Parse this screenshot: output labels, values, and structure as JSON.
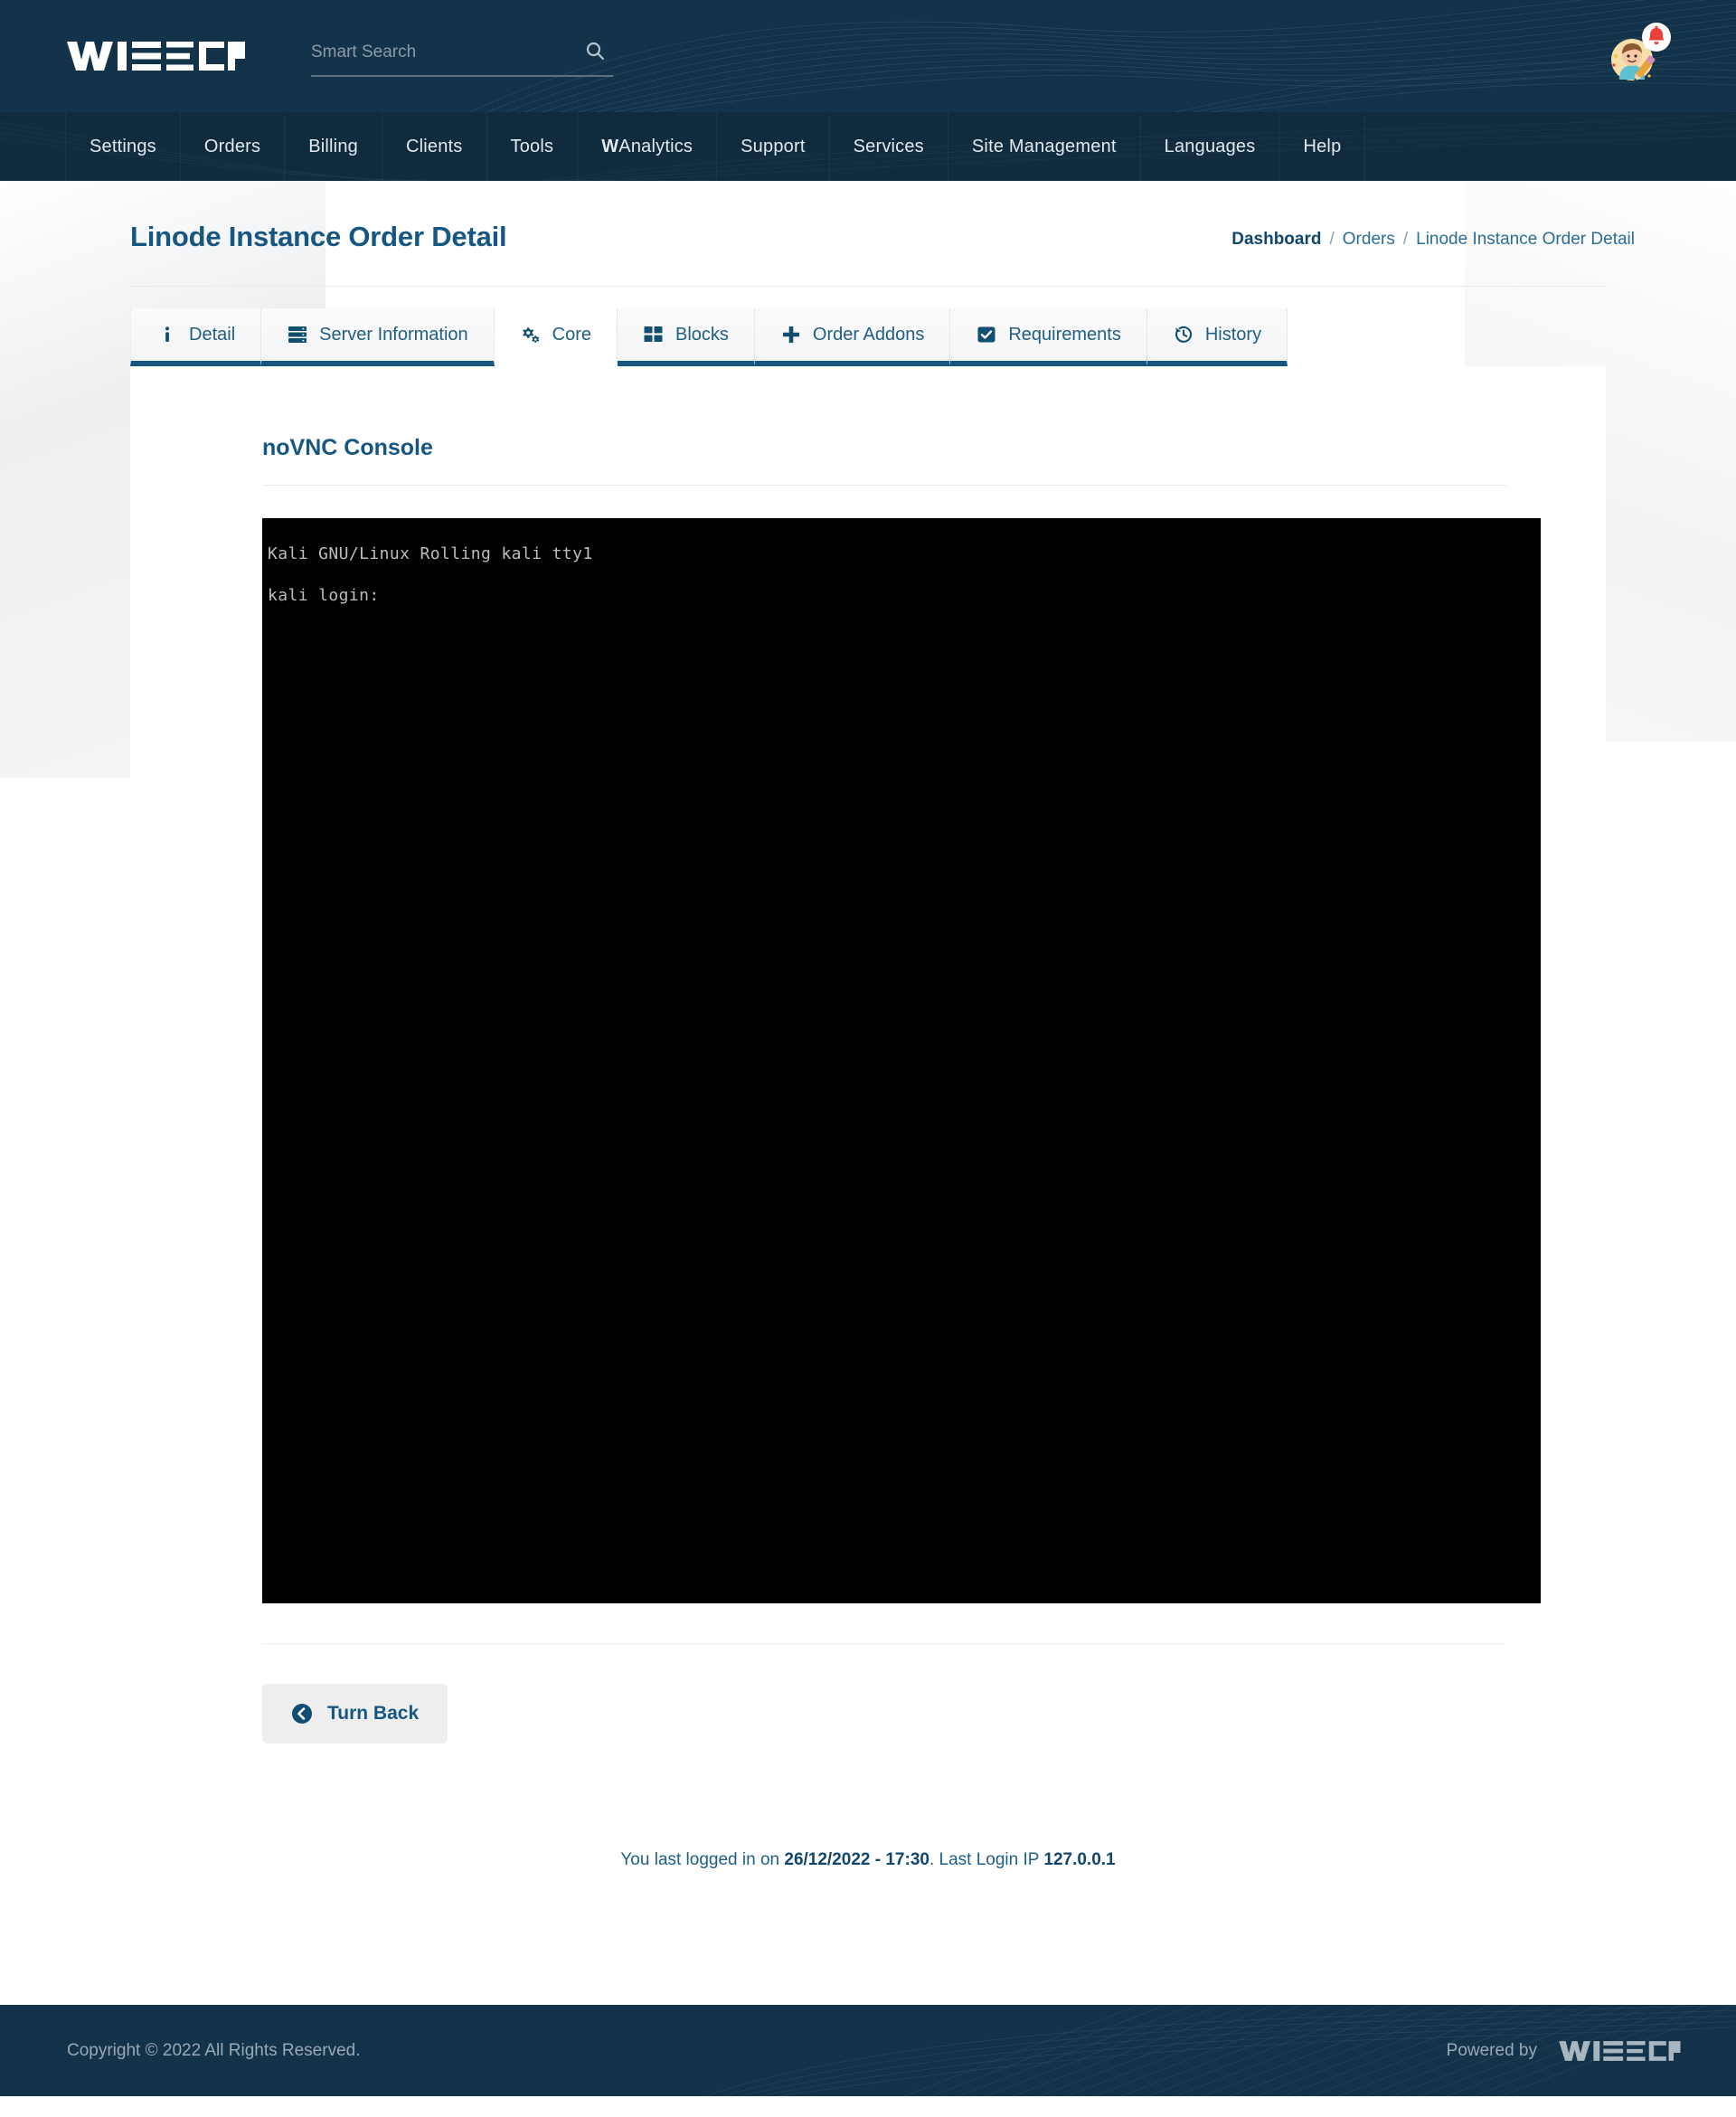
{
  "brand": {
    "logo_text": "WISECP",
    "accent": "#155682",
    "header_bg": "#123349",
    "nav_bg": "#0f2b3d"
  },
  "header": {
    "search": {
      "placeholder": "Smart Search",
      "value": "",
      "icon": "search-icon"
    },
    "avatar": {
      "icon": "user-avatar-icon",
      "badge_icon": "bell-icon",
      "badge_color": "#e8413a"
    }
  },
  "nav": {
    "items": [
      {
        "label": "Settings"
      },
      {
        "label": "Orders"
      },
      {
        "label": "Billing"
      },
      {
        "label": "Clients"
      },
      {
        "label": "Tools"
      },
      {
        "label": "WAnalytics",
        "bold_prefix": "W",
        "rest": "Analytics"
      },
      {
        "label": "Support"
      },
      {
        "label": "Services"
      },
      {
        "label": "Site Management"
      },
      {
        "label": "Languages"
      },
      {
        "label": "Help"
      }
    ]
  },
  "page": {
    "title": "Linode Instance Order Detail",
    "breadcrumb": {
      "root": "Dashboard",
      "sep": "/",
      "middle": "Orders",
      "current": "Linode Instance Order Detail"
    }
  },
  "tabs": [
    {
      "label": "Detail",
      "icon": "info-icon",
      "active": false
    },
    {
      "label": "Server Information",
      "icon": "server-icon",
      "active": false
    },
    {
      "label": "Core",
      "icon": "gears-icon",
      "active": true
    },
    {
      "label": "Blocks",
      "icon": "blocks-icon",
      "active": false
    },
    {
      "label": "Order Addons",
      "icon": "plus-icon",
      "active": false
    },
    {
      "label": "Requirements",
      "icon": "checkbox-icon",
      "active": false
    },
    {
      "label": "History",
      "icon": "history-clock-icon",
      "active": false
    }
  ],
  "panel": {
    "section_title": "noVNC Console",
    "console": {
      "lines": [
        "Kali GNU/Linux Rolling kali tty1",
        "",
        "kali login:"
      ]
    },
    "turn_back": {
      "label": "Turn Back",
      "icon": "circle-chevron-left-icon"
    }
  },
  "status": {
    "last_login_prefix": "You last logged in on ",
    "last_login_datetime": "26/12/2022 - 17:30",
    "last_login_middle": ". Last Login IP ",
    "last_login_ip": "127.0.0.1"
  },
  "footer": {
    "copyright": "Copyright © 2022 All Rights Reserved.",
    "powered_by": "Powered by",
    "powered_logo": "WISECP"
  }
}
